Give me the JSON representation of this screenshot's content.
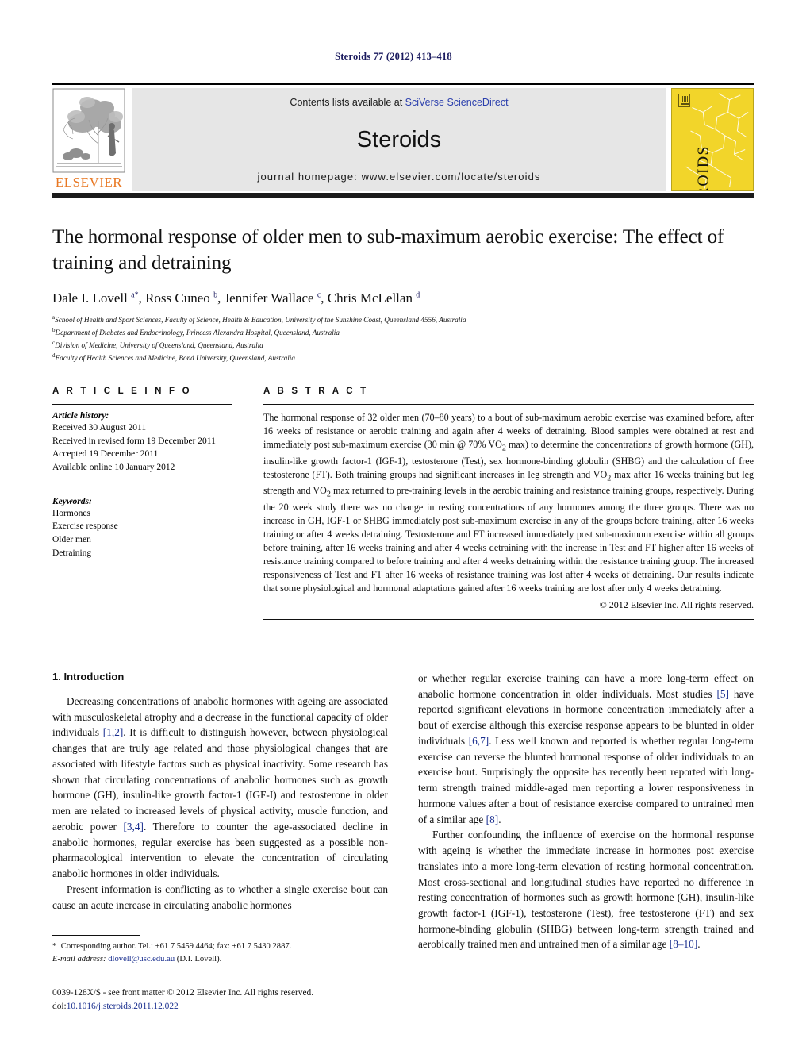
{
  "running_head": "Steroids 77 (2012) 413–418",
  "banner": {
    "publisher_name": "ELSEVIER",
    "contents_prefix": "Contents lists available at ",
    "contents_link": "SciVerse ScienceDirect",
    "journal_name": "Steroids",
    "homepage": "journal homepage: www.elsevier.com/locate/steroids",
    "cover_title": "STEROIDS",
    "cover_color": "#f2d52a",
    "link_color": "#2b3fad"
  },
  "article": {
    "title": "The hormonal response of older men to sub-maximum aerobic exercise: The effect of training and detraining",
    "authors_html": "Dale I. Lovell <sup>a</sup><sup>*</sup>, Ross Cuneo <sup>b</sup>, Jennifer Wallace <sup>c</sup>, Chris McLellan <sup>d</sup>",
    "affiliations": [
      "School of Health and Sport Sciences, Faculty of Science, Health & Education, University of the Sunshine Coast, Queensland 4556, Australia",
      "Department of Diabetes and Endocrinology, Princess Alexandra Hospital, Queensland, Australia",
      "Division of Medicine, University of Queensland, Queensland, Australia",
      "Faculty of Health Sciences and Medicine, Bond University, Queensland, Australia"
    ],
    "affiliation_marks": [
      "a",
      "b",
      "c",
      "d"
    ]
  },
  "article_info": {
    "heading": "A R T I C L E   I N F O",
    "history_label": "Article history:",
    "history": [
      "Received 30 August 2011",
      "Received in revised form 19 December 2011",
      "Accepted 19 December 2011",
      "Available online 10 January 2012"
    ],
    "keywords_label": "Keywords:",
    "keywords": [
      "Hormones",
      "Exercise response",
      "Older men",
      "Detraining"
    ]
  },
  "abstract": {
    "heading": "A B S T R A C T",
    "text_html": "The hormonal response of 32 older men (70–80 years) to a bout of sub-maximum aerobic exercise was examined before, after 16 weeks of resistance or aerobic training and again after 4 weeks of detraining. Blood samples were obtained at rest and immediately post sub-maximum exercise (30 min @ 70% VO<sub>2</sub> max) to determine the concentrations of growth hormone (GH), insulin-like growth factor-1 (IGF-1), testosterone (Test), sex hormone-binding globulin (SHBG) and the calculation of free testosterone (FT). Both training groups had significant increases in leg strength and VO<sub>2</sub> max after 16 weeks training but leg strength and VO<sub>2</sub> max returned to pre-training levels in the aerobic training and resistance training groups, respectively. During the 20 week study there was no change in resting concentrations of any hormones among the three groups. There was no increase in GH, IGF-1 or SHBG immediately post sub-maximum exercise in any of the groups before training, after 16 weeks training or after 4 weeks detraining. Testosterone and FT increased immediately post sub-maximum exercise within all groups before training, after 16 weeks training and after 4 weeks detraining with the increase in Test and FT higher after 16 weeks of resistance training compared to before training and after 4 weeks detraining within the resistance training group. The increased responsiveness of Test and FT after 16 weeks of resistance training was lost after 4 weeks of detraining. Our results indicate that some physiological and hormonal adaptations gained after 16 weeks training are lost after only 4 weeks detraining.",
    "copyright": "© 2012 Elsevier Inc. All rights reserved."
  },
  "introduction": {
    "section_number_title": "1. Introduction",
    "left_paragraphs_html": [
      "Decreasing concentrations of anabolic hormones with ageing are associated with musculoskeletal atrophy and a decrease in the functional capacity of older individuals <span class=\"cite\">[1,2]</span>. It is difficult to distinguish however, between physiological changes that are truly age related and those physiological changes that are associated with lifestyle factors such as physical inactivity. Some research has shown that circulating concentrations of anabolic hormones such as growth hormone (GH), insulin-like growth factor-1 (IGF-I) and testosterone in older men are related to increased levels of physical activity, muscle function, and aerobic power <span class=\"cite\">[3,4]</span>. Therefore to counter the age-associated decline in anabolic hormones, regular exercise has been suggested as a possible non-pharmacological intervention to elevate the concentration of circulating anabolic hormones in older individuals.",
      "Present information is conflicting as to whether a single exercise bout can cause an acute increase in circulating anabolic hormones"
    ],
    "right_paragraphs_html": [
      "or whether regular exercise training can have a more long-term effect on anabolic hormone concentration in older individuals. Most studies <span class=\"cite\">[5]</span> have reported significant elevations in hormone concentration immediately after a bout of exercise although this exercise response appears to be blunted in older individuals <span class=\"cite\">[6,7]</span>. Less well known and reported is whether regular long-term exercise can reverse the blunted hormonal response of older individuals to an exercise bout. Surprisingly the opposite has recently been reported with long-term strength trained middle-aged men reporting a lower responsiveness in hormone values after a bout of resistance exercise compared to untrained men of a similar age <span class=\"cite\">[8]</span>.",
      "Further confounding the influence of exercise on the hormonal response with ageing is whether the immediate increase in hormones post exercise translates into a more long-term elevation of resting hormonal concentration. Most cross-sectional and longitudinal studies have reported no difference in resting concentration of hormones such as growth hormone (GH), insulin-like growth factor-1 (IGF-1), testosterone (Test), free testosterone (FT) and sex hormone-binding globulin (SHBG) between long-term strength trained and aerobically trained men and untrained men of a similar age <span class=\"cite\">[8–10]</span>."
    ]
  },
  "footnote": {
    "corresponding_html": "<span class=\"star\">*</span>&nbsp; Corresponding author. Tel.: +61 7 5459 4464; fax: +61 7 5430 2887.",
    "email_html": "<em>E-mail address:</em> <span class=\"mail-link\">dlovell@usc.edu.au</span> (D.I. Lovell)."
  },
  "footer": {
    "issn_line": "0039-128X/$ - see front matter © 2012 Elsevier Inc. All rights reserved.",
    "doi_prefix": "doi:",
    "doi_value": "10.1016/j.steroids.2011.12.022"
  }
}
